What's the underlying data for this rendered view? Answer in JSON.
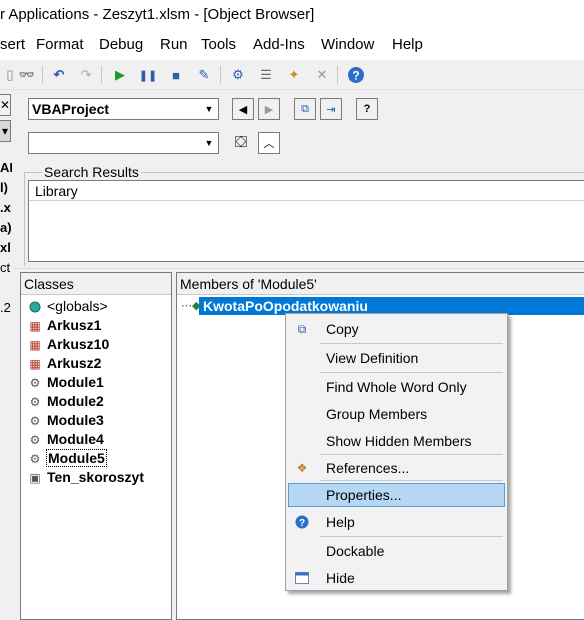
{
  "window": {
    "title": "r Applications - Zeszyt1.xlsm - [Object Browser]"
  },
  "menu": [
    "sert",
    "Format",
    "Debug",
    "Run",
    "Tools",
    "Add-Ins",
    "Window",
    "Help"
  ],
  "menu_mnemonics": [
    "",
    "o",
    "D",
    "R",
    "T",
    "A",
    "W",
    "H"
  ],
  "toolbar_icons": [
    "find-icon",
    "undo-icon",
    "redo-icon",
    "run-icon",
    "break-icon",
    "reset-icon",
    "design-mode-icon",
    "project-explorer-icon",
    "properties-window-icon",
    "object-browser-icon",
    "toolbox-icon",
    "help-icon"
  ],
  "left_strip": {
    "labels": [
      "AE",
      "l)",
      ".x",
      "a)",
      "xl",
      "ct",
      ".2"
    ]
  },
  "object_browser": {
    "library_combo": "VBAProject",
    "search_combo": "",
    "search_results_label": "Search Results",
    "library_column": "Library",
    "classes_header": "Classes",
    "members_header": "Members of 'Module5'",
    "classes": [
      {
        "name": "<globals>",
        "icon": "globals-icon",
        "bold": false
      },
      {
        "name": "Arkusz1",
        "icon": "worksheet-icon",
        "bold": true
      },
      {
        "name": "Arkusz10",
        "icon": "worksheet-icon",
        "bold": true
      },
      {
        "name": "Arkusz2",
        "icon": "worksheet-icon",
        "bold": true
      },
      {
        "name": "Module1",
        "icon": "module-icon",
        "bold": true
      },
      {
        "name": "Module2",
        "icon": "module-icon",
        "bold": true
      },
      {
        "name": "Module3",
        "icon": "module-icon",
        "bold": true
      },
      {
        "name": "Module4",
        "icon": "module-icon",
        "bold": true
      },
      {
        "name": "Module5",
        "icon": "module-icon",
        "bold": true,
        "selected": true
      },
      {
        "name": "Ten_skoroszyt",
        "icon": "workbook-icon",
        "bold": true
      }
    ],
    "members": [
      {
        "name": "KwotaPoOpodatkowaniu",
        "icon": "method-icon",
        "selected": true
      }
    ]
  },
  "context_menu": {
    "items": [
      {
        "label": "Copy",
        "icon": "copy-icon"
      },
      {
        "label": "View Definition"
      },
      {
        "label": "Find Whole Word Only"
      },
      {
        "label": "Group Members"
      },
      {
        "label": "Show Hidden Members"
      },
      {
        "label": "References...",
        "icon": "references-icon"
      },
      {
        "label": "Properties...",
        "highlighted": true
      },
      {
        "label": "Help",
        "icon": "help-icon"
      },
      {
        "label": "Dockable"
      },
      {
        "label": "Hide",
        "icon": "hide-window-icon"
      }
    ]
  },
  "colors": {
    "selection": "#0078d7",
    "menu_highlight": "#b6d7f4",
    "background": "#f0f0f0"
  }
}
